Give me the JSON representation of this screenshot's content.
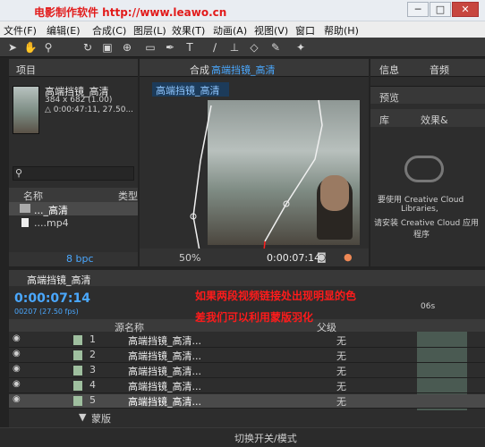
{
  "watermark": "电影制作软件  http://www.leawo.cn",
  "window": {
    "min": "─",
    "max": "□",
    "close": "✕"
  },
  "menu": [
    "文件(F)",
    "编辑(E)",
    "合成(C)",
    "图层(L)",
    "效果(T)",
    "动画(A)",
    "视图(V)",
    "窗口",
    "帮助(H)"
  ],
  "tools": [
    "arrow-icon",
    "hand-icon",
    "zoom-icon",
    "rotate-icon",
    "camera-icon",
    "pan-behind-icon",
    "rect-icon",
    "pen-icon",
    "text-icon",
    "brush-icon",
    "stamp-icon",
    "eraser-icon",
    "roto-icon",
    "puppet-icon"
  ],
  "project": {
    "tab": "项目",
    "item_name": "高端挡镜_高清",
    "item_dims": "384 x 682 (1.00)",
    "item_dur": "△ 0:00:47:11, 27.50...",
    "col_name": "名称",
    "col_type": "类型",
    "rows": [
      "..._高清",
      "....mp4"
    ],
    "bpc": "8 bpc"
  },
  "comp": {
    "tab": "合成",
    "comp_name": "高端挡镜_高清",
    "tab_chip": "高端挡镜_高清",
    "zoom": "50%",
    "time": "0:00:07:14"
  },
  "info": {
    "tab1": "信息",
    "tab2": "音频",
    "tab3": "预览",
    "tab4": "库",
    "tab5": "效果&",
    "cc1": "要使用 Creative Cloud",
    "cc2": "Libraries,",
    "cc3": "请安装 Creative Cloud 应用",
    "cc4": "程序"
  },
  "timeline": {
    "tab": "高端挡镜_高清",
    "timecode": "0:00:07:14",
    "frames": "00207 (27.50 fps)",
    "col_source": "源名称",
    "col_parent": "父级",
    "ruler": "06s",
    "rows": [
      {
        "num": "1",
        "name": "高端挡镜_高清...",
        "parent": "无"
      },
      {
        "num": "2",
        "name": "高端挡镜_高清...",
        "parent": "无"
      },
      {
        "num": "3",
        "name": "高端挡镜_高清...",
        "parent": "无"
      },
      {
        "num": "4",
        "name": "高端挡镜_高清...",
        "parent": "无"
      },
      {
        "num": "5",
        "name": "高端挡镜_高清...",
        "parent": "无"
      }
    ],
    "mask": "蒙版"
  },
  "annotation": {
    "line1": "如果两段视频链接处出现明显的色",
    "line2": "差我们可以利用蒙版羽化"
  },
  "bottom": {
    "toggle": "切换开关/模式"
  }
}
